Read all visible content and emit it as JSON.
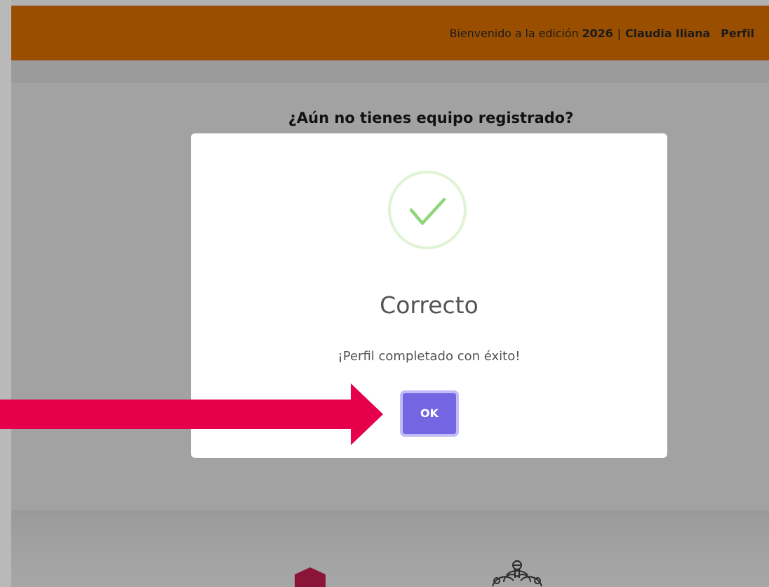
{
  "header": {
    "welcome_text": "Bienvenido a la edición",
    "edition_year": "2026",
    "separator": "|",
    "user_name": "Claudia Iliana",
    "profile_link": "Perfil",
    "background_color": "#9a4f00"
  },
  "page": {
    "question": "¿Aún no tienes equipo registrado?"
  },
  "modal": {
    "icon": "success-check-icon",
    "title": "Correcto",
    "message": "¡Perfil completado con éxito!",
    "ok_label": "OK",
    "button_color": "#7465e2"
  },
  "annotation": {
    "arrow_color": "#e6004c",
    "arrow_icon": "right-arrow-icon"
  },
  "footer": {
    "logos": [
      "logo-left-icon",
      "crest-logo-icon"
    ]
  }
}
